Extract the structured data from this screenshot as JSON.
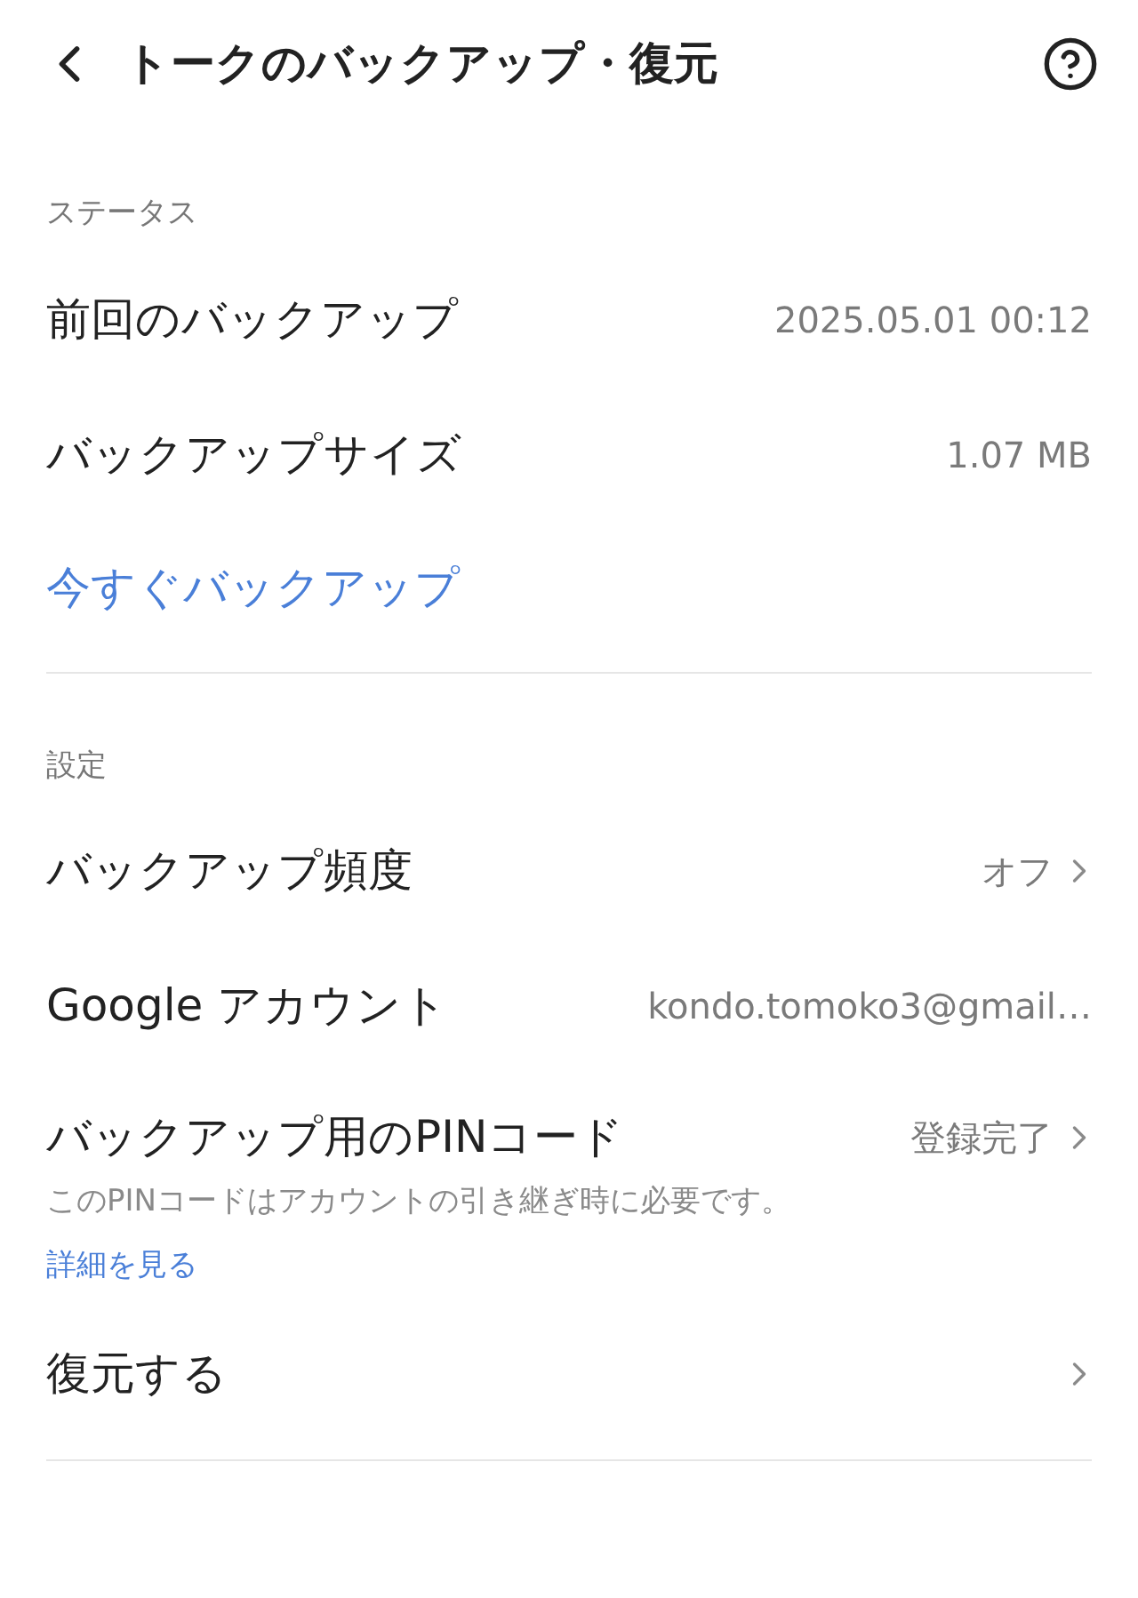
{
  "header": {
    "title": "トークのバックアップ・復元"
  },
  "sections": [
    {
      "title": "ステータス",
      "items": [
        {
          "kind": "value",
          "label": "前回のバックアップ",
          "value": "2025.05.01 00:12",
          "chevron": false
        },
        {
          "kind": "value",
          "label": "バックアップサイズ",
          "value": "1.07 MB",
          "chevron": false
        },
        {
          "kind": "link",
          "label": "今すぐバックアップ"
        }
      ]
    },
    {
      "title": "設定",
      "items": [
        {
          "kind": "value",
          "label": "バックアップ頻度",
          "value": "オフ",
          "chevron": true
        },
        {
          "kind": "value",
          "label": "Google アカウント",
          "value": "kondo.tomoko3@gmail…",
          "chevron": false
        },
        {
          "kind": "value",
          "label": "バックアップ用のPINコード",
          "value": "登録完了",
          "chevron": true,
          "note": "このPINコードはアカウントの引き継ぎ時に必要です。",
          "note_link": "詳細を見る"
        },
        {
          "kind": "value",
          "label": "復元する",
          "chevron": true
        }
      ]
    }
  ]
}
